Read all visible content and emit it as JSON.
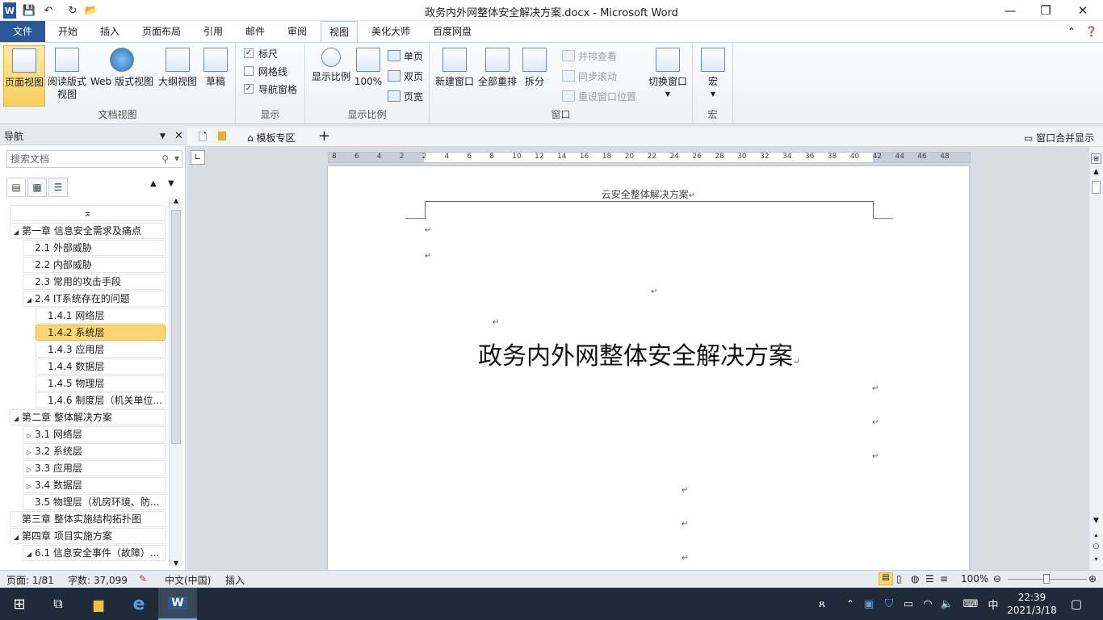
{
  "window": {
    "title": "政务内外网整体安全解决方案.docx - Microsoft Word"
  },
  "qat": {
    "word_icon": "W",
    "save": "💾",
    "undo": "↶",
    "redo": "↻",
    "open": "📂"
  },
  "tabs": [
    "文件",
    "开始",
    "插入",
    "页面布局",
    "引用",
    "邮件",
    "审阅",
    "视图",
    "美化大师",
    "百度网盘"
  ],
  "ribbon": {
    "doc_views": {
      "label": "文档视图",
      "buttons": [
        "页面视图",
        "阅读版式\n视图",
        "Web 版式视图",
        "大纲视图",
        "草稿"
      ]
    },
    "show": {
      "label": "显示",
      "items": [
        {
          "text": "标尺",
          "checked": true
        },
        {
          "text": "网格线",
          "checked": false
        },
        {
          "text": "导航窗格",
          "checked": true
        }
      ]
    },
    "zoom": {
      "label": "显示比例",
      "zoom_btn": "显示比例",
      "pct_btn": "100%",
      "one_page": "单页",
      "two_page": "双页",
      "page_width": "页宽"
    },
    "window": {
      "label": "窗口",
      "new_window": "新建窗口",
      "arrange_all": "全部重排",
      "split": "拆分",
      "side_by_side": "并排查看",
      "sync_scroll": "同步滚动",
      "reset_pos": "重设窗口位置",
      "switch": "切换窗口"
    },
    "macro": {
      "label": "宏",
      "btn": "宏"
    }
  },
  "nav": {
    "title": "导航",
    "search_placeholder": "搜索文档",
    "items": [
      {
        "text": "第一章 信息安全需求及痛点",
        "level": 0,
        "arrow": "◢"
      },
      {
        "text": "2.1 外部威胁",
        "level": 1,
        "arrow": ""
      },
      {
        "text": "2.2 内部威胁",
        "level": 1,
        "arrow": ""
      },
      {
        "text": "2.3 常用的攻击手段",
        "level": 1,
        "arrow": ""
      },
      {
        "text": "2.4 IT系统存在的问题",
        "level": 1,
        "arrow": "◢"
      },
      {
        "text": "1.4.1 网络层",
        "level": 2,
        "arrow": ""
      },
      {
        "text": "1.4.2 系统层",
        "level": 2,
        "arrow": "",
        "selected": true
      },
      {
        "text": "1.4.3 应用层",
        "level": 2,
        "arrow": ""
      },
      {
        "text": "1.4.4 数据层",
        "level": 2,
        "arrow": ""
      },
      {
        "text": "1.4.5 物理层",
        "level": 2,
        "arrow": ""
      },
      {
        "text": "1.4.6 制度层（机关单位...",
        "level": 2,
        "arrow": ""
      },
      {
        "text": "第二章 整体解决方案",
        "level": 0,
        "arrow": "◢"
      },
      {
        "text": "3.1 网络层",
        "level": 1,
        "arrow": "▷"
      },
      {
        "text": "3.2 系统层",
        "level": 1,
        "arrow": "▷"
      },
      {
        "text": "3.3 应用层",
        "level": 1,
        "arrow": "▷"
      },
      {
        "text": "3.4 数据层",
        "level": 1,
        "arrow": "▷"
      },
      {
        "text": "3.5 物理层（机房环境、防...",
        "level": 1,
        "arrow": ""
      },
      {
        "text": "第三章 整体实施结构拓扑图",
        "level": 0,
        "arrow": ""
      },
      {
        "text": "第四章 项目实施方案",
        "level": 0,
        "arrow": "◢"
      },
      {
        "text": "6.1 信息安全事件（故障）...",
        "level": 1,
        "arrow": "◢"
      }
    ]
  },
  "doc_toolbar": {
    "template": "模板专区",
    "merge": "窗口合并显示"
  },
  "ruler": {
    "labels": [
      "8",
      "6",
      "4",
      "2",
      "2",
      "4",
      "6",
      "8",
      "10",
      "12",
      "14",
      "16",
      "18",
      "20",
      "22",
      "24",
      "26",
      "28",
      "30",
      "32",
      "34",
      "36",
      "38",
      "40",
      "42",
      "44",
      "46",
      "48"
    ]
  },
  "document": {
    "header": "云安全整体解决方案",
    "title": "政务内外网整体安全解决方案",
    "para_mark": "↵"
  },
  "status": {
    "page": "页面: 1/81",
    "words": "字数: 37,099",
    "lang": "中文(中国)",
    "mode": "插入",
    "zoom": "100%"
  },
  "taskbar": {
    "time": "22:39",
    "date": "2021/3/18",
    "ime": "中"
  }
}
